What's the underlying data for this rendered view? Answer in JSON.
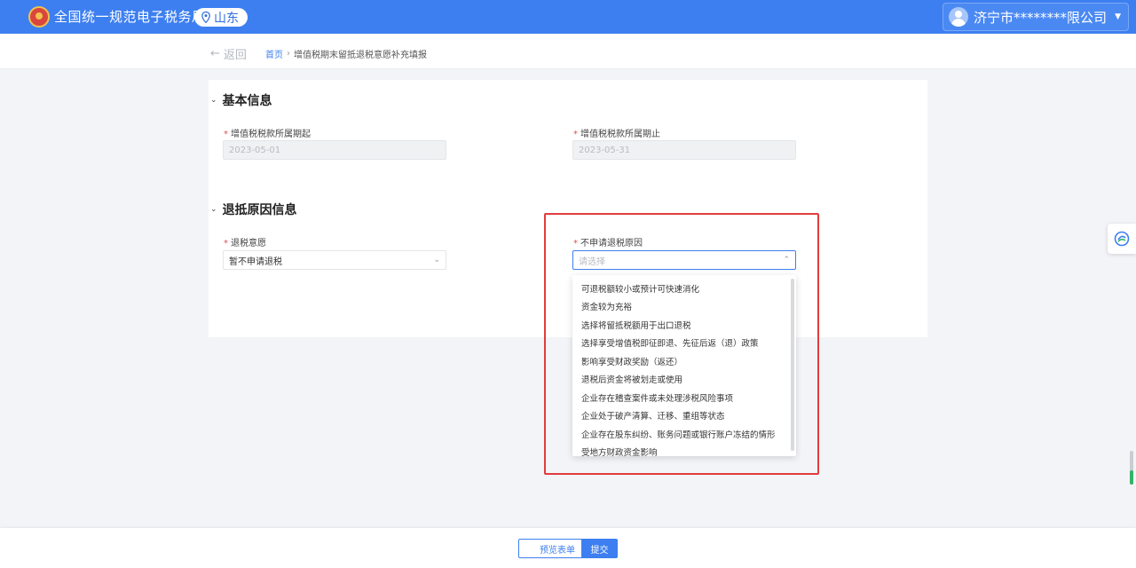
{
  "header": {
    "site_title": "全国统一规范电子税务局",
    "region": "山东",
    "user_name": "济宁市********限公司"
  },
  "nav": {
    "back_label": "返回",
    "breadcrumb_home": "首页",
    "breadcrumb_sep": "›",
    "breadcrumb_current": "增值税期末留抵退税意愿补充填报"
  },
  "basic": {
    "title": "基本信息",
    "start_label": "增值税税款所属期起",
    "start_value": "2023-05-01",
    "end_label": "增值税税款所属期止",
    "end_value": "2023-05-31"
  },
  "reason": {
    "title": "退抵原因信息",
    "intent_label": "退税意愿",
    "intent_value": "暂不申请退税",
    "reason_label": "不申请退税原因",
    "reason_placeholder": "请选择"
  },
  "dropdown": {
    "options": [
      "可退税额较小或预计可快速消化",
      "资金较为充裕",
      "选择将留抵税额用于出口退税",
      "选择享受增值税即征即退、先征后返（退）政策",
      "影响享受财政奖励（返还）",
      "退税后资金将被划走或使用",
      "企业存在稽查案件或未处理涉税风险事项",
      "企业处于破产清算、迁移、重组等状态",
      "企业存在股东纠纷、账务问题或银行账户冻结的情形",
      "受地方财政资金影响"
    ]
  },
  "footer": {
    "preview_label": "预览表单",
    "submit_label": "提交"
  },
  "colors": {
    "primary": "#3d7ff0",
    "highlight": "#e23c3c",
    "required": "#e34d4d"
  }
}
